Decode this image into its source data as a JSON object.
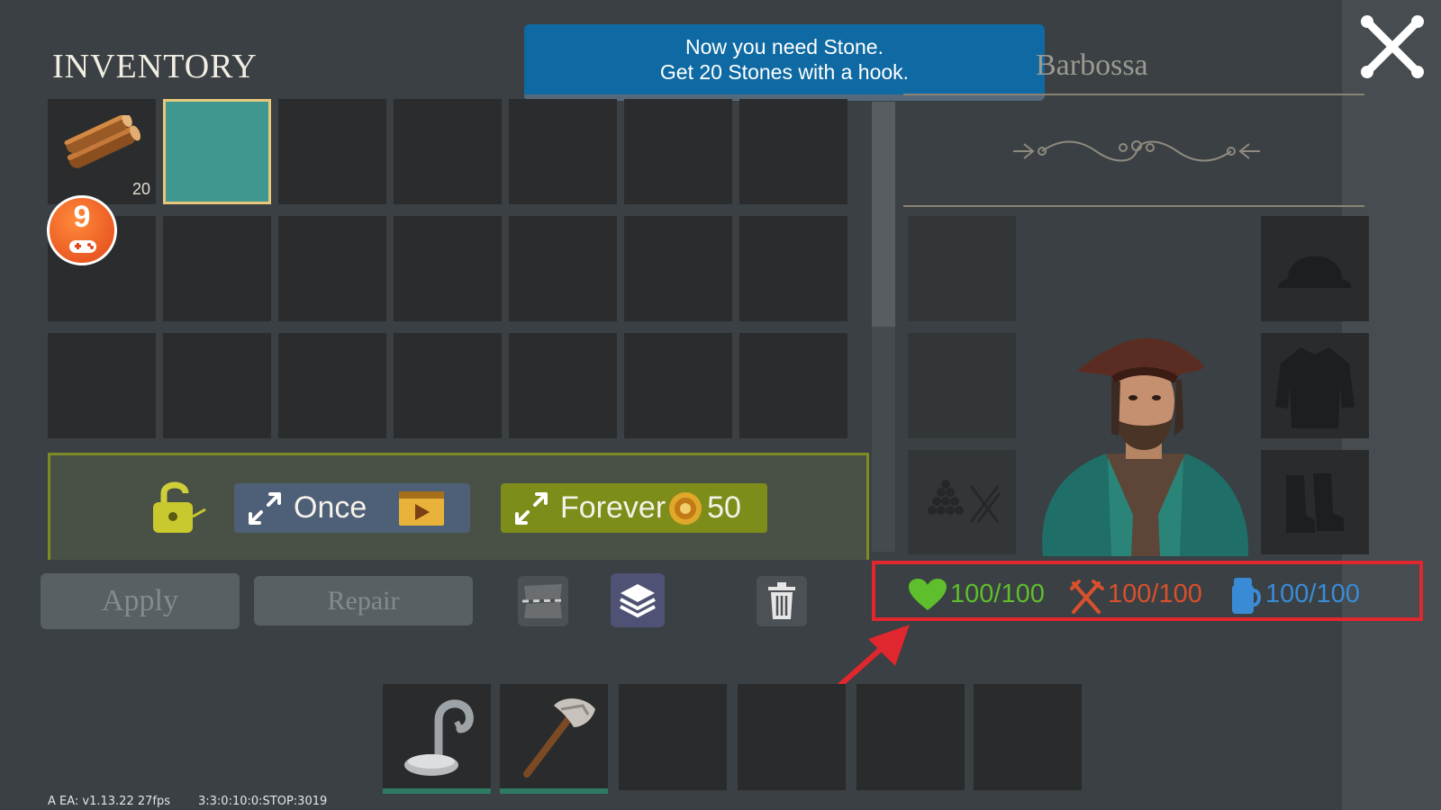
{
  "inventory": {
    "title": "INVENTORY"
  },
  "tutorial": {
    "line1": "Now you need Stone.",
    "line2": "Get 20 Stones with a hook."
  },
  "character": {
    "name": "Barbossa"
  },
  "slots": {
    "wood_count": "20"
  },
  "badge": {
    "number": "9"
  },
  "unlock": {
    "once_label": "Once",
    "forever_label": "Forever",
    "forever_price": "50"
  },
  "actions": {
    "apply_label": "Apply",
    "repair_label": "Repair"
  },
  "stats": {
    "health": "100/100",
    "hunger": "100/100",
    "thirst": "100/100",
    "health_color": "#5fbe2c",
    "hunger_color": "#d9502d",
    "thirst_color": "#3a8bd6"
  },
  "debug": {
    "version": "A EA: v1.13.22  27fps",
    "info": "3:3:0:10:0:STOP:3019"
  },
  "icons": {
    "close": "close-x-icon",
    "wood": "wood-logs-icon",
    "hook": "hook-icon",
    "axe": "stone-axe-icon",
    "lock": "padlock-icon",
    "trash": "trash-icon"
  }
}
